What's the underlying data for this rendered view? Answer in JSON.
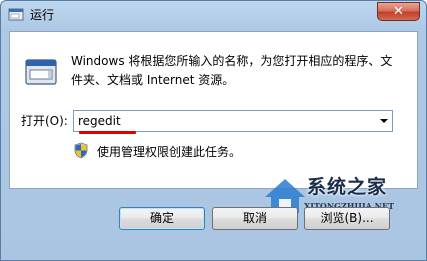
{
  "window": {
    "title": "运行",
    "close_glyph": "✕"
  },
  "content": {
    "description": "Windows 将根据您所输入的名称，为您打开相应的程序、文件夹、文档或 Internet 资源。",
    "open_label": "打开(O):",
    "open_value": "regedit",
    "admin_note": "使用管理权限创建此任务。"
  },
  "buttons": {
    "ok": "确定",
    "cancel": "取消",
    "browse": "浏览(B)..."
  },
  "watermark": {
    "text": "系统之家",
    "url": "XITONGZHIJIA.NET"
  },
  "icons": {
    "title": "run-icon",
    "main": "run-dialog-icon",
    "shield": "uac-shield-icon",
    "dropdown": "chevron-down-icon"
  },
  "colors": {
    "underline": "#e10000",
    "close": "#c0402a",
    "frame": "#aec9e5"
  }
}
